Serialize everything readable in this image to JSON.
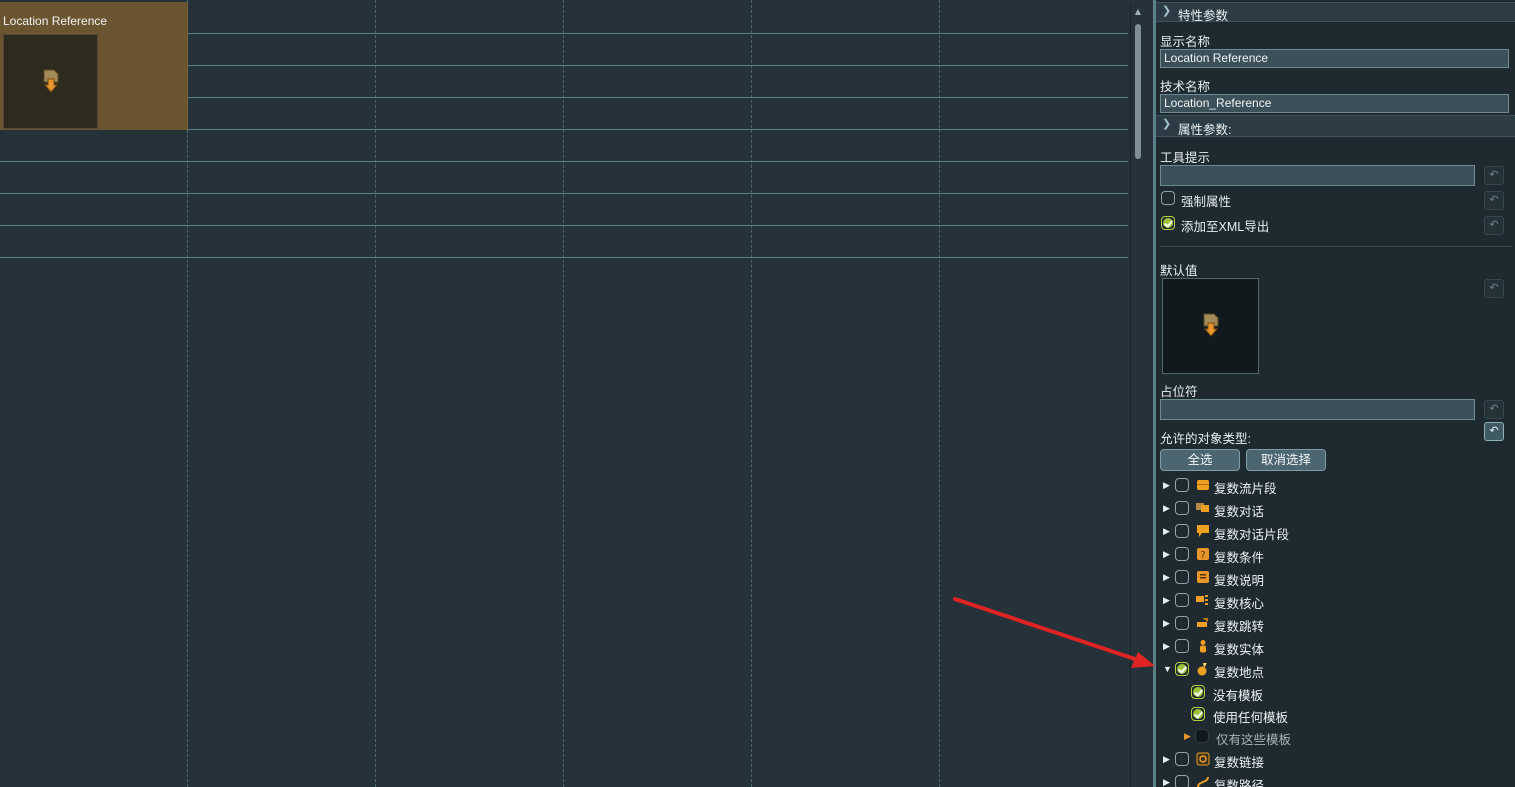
{
  "canvas": {
    "node": {
      "title": "Location Reference"
    }
  },
  "panel": {
    "section_properties": {
      "label": "特性参数"
    },
    "display_name": {
      "label": "显示名称",
      "value": "Location Reference"
    },
    "technical_name": {
      "label": "技术名称",
      "value": "Location_Reference"
    },
    "section_attributes": {
      "label": "属性参数:"
    },
    "tooltip": {
      "label": "工具提示",
      "value": ""
    },
    "mandatory": {
      "label": "强制属性",
      "checked": false
    },
    "xml_export": {
      "label": "添加至XML导出",
      "checked": true
    },
    "default_value": {
      "label": "默认值"
    },
    "placeholder": {
      "label": "占位符",
      "value": ""
    },
    "allowed_types": {
      "label": "允许的对象类型:",
      "select_all": "全选",
      "deselect": "取消选择",
      "items": [
        {
          "label": "复数流片段",
          "icon": "flow-fragment-icon",
          "checked": false,
          "expanded": false
        },
        {
          "label": "复数对话",
          "icon": "dialogue-icon",
          "checked": false,
          "expanded": false
        },
        {
          "label": "复数对话片段",
          "icon": "dialogue-fragment-icon",
          "checked": false,
          "expanded": false
        },
        {
          "label": "复数条件",
          "icon": "condition-icon",
          "checked": false,
          "expanded": false
        },
        {
          "label": "复数说明",
          "icon": "comment-icon",
          "checked": false,
          "expanded": false
        },
        {
          "label": "复数核心",
          "icon": "hub-icon",
          "checked": false,
          "expanded": false
        },
        {
          "label": "复数跳转",
          "icon": "jump-icon",
          "checked": false,
          "expanded": false
        },
        {
          "label": "复数实体",
          "icon": "entity-icon",
          "checked": false,
          "expanded": false
        },
        {
          "label": "复数地点",
          "icon": "location-icon",
          "checked": true,
          "expanded": true
        },
        {
          "label": "复数链接",
          "icon": "link-icon",
          "checked": false,
          "expanded": false
        },
        {
          "label": "复数路径",
          "icon": "path-icon",
          "checked": false,
          "expanded": false
        }
      ],
      "location_children": [
        {
          "label": "没有模板",
          "checked": true
        },
        {
          "label": "使用任何模板",
          "checked": true
        },
        {
          "label": "仅有这些模板",
          "checked": false
        }
      ]
    }
  },
  "colors": {
    "node_fill": "#6a5530",
    "accent_orange": "#e8962a",
    "check_green": "#9bc23a",
    "annotation_red": "#e02424"
  }
}
